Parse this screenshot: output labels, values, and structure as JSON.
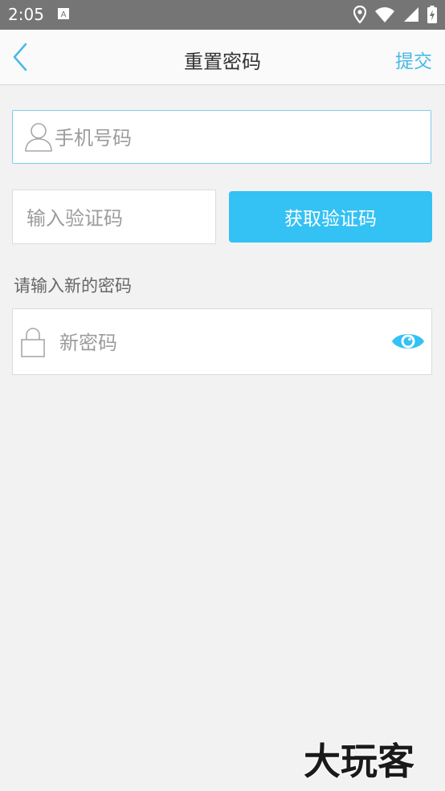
{
  "status_bar": {
    "time": "2:05"
  },
  "header": {
    "title": "重置密码",
    "submit_label": "提交"
  },
  "form": {
    "phone_placeholder": "手机号码",
    "code_placeholder": "输入验证码",
    "get_code_label": "获取验证码",
    "new_password_hint": "请输入新的密码",
    "new_password_placeholder": "新密码"
  },
  "watermark": {
    "text": "大玩客"
  },
  "colors": {
    "accent": "#34c1f4",
    "link": "#47b9e8",
    "status_bar": "#757575"
  }
}
